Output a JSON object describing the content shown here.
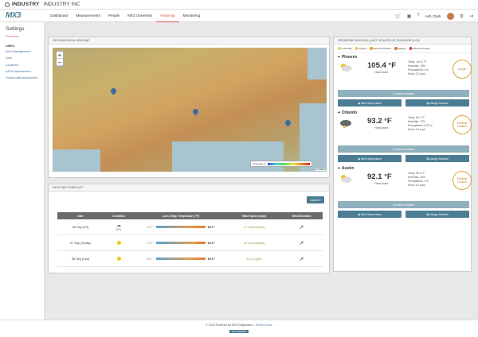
{
  "top": {
    "logo": "INDUSTRY",
    "company": "INDUSTRY INC"
  },
  "nav": {
    "brand": "MX3",
    "items": [
      "Dashboard",
      "Measurements",
      "People",
      "MX3 University",
      "Heatmap",
      "Monitoring"
    ],
    "active": "Heatmap",
    "user": "Ash Clark"
  },
  "sidebar": {
    "title": "Settings",
    "items": [
      "Overview"
    ],
    "links_head": "LINKS",
    "links": [
      "Alert Management",
      "Jobs",
      "Locations",
      "ASSH assessment",
      "Global staff assessment"
    ]
  },
  "map": {
    "title": "GEOGRAPHICAL HEATMAP",
    "zoom_in": "+",
    "zoom_out": "−",
    "legend_label": "Temperature °F",
    "legend_ticks": [
      "60",
      "70",
      "80",
      "90",
      "100",
      "110"
    ],
    "attribution": "© Leaflet"
  },
  "weather": {
    "title": "WEATHER FORECAST",
    "location_select": "Austin",
    "columns": [
      "Date",
      "Condition",
      "Low & High Temperature (°F)",
      "Wind Speed (mph)",
      "Wind Direction"
    ],
    "rows": [
      {
        "date": "06 Sep (Fri)",
        "cond_text": "60%",
        "low": "74.3 °",
        "high": "89.0 °",
        "wind": "17.3 (Moderate)",
        "low_v": 74.3,
        "high_v": 89.0
      },
      {
        "date": "07 Sep (Today)",
        "cond_text": "",
        "low": "74.3 °",
        "high": "92.5 °",
        "wind": "16.6 (Moderate)",
        "low_v": 74.3,
        "high_v": 92.5
      },
      {
        "date": "08 Sep (Sun)",
        "cond_text": "",
        "low": "69.3 °",
        "high": "89.5 °",
        "wind": "11.6 (Light)",
        "low_v": 69.3,
        "high_v": 89.5
      }
    ]
  },
  "regions": {
    "title": "OPERATING REGIONS (LAST UPDATED AT 2024/09/08 14:00)",
    "legend": [
      {
        "label": "Less Risk",
        "color": "#d7e36a"
      },
      {
        "label": "Caution",
        "color": "#f0c02f"
      },
      {
        "label": "Extreme Caution",
        "color": "#f0a02a"
      },
      {
        "label": "Danger",
        "color": "#e0742a"
      },
      {
        "label": "Extreme Danger",
        "color": "#d9342b"
      }
    ],
    "items": [
      {
        "name": "Phoenix",
        "temp": "105.4 °F",
        "heat_index": "Heat Index",
        "stat1": "Temp: 109.3 °F",
        "stat2": "Humidity: 13%",
        "stat3": "Precipitation: 0 in",
        "stat4": "Wind: 2.2 mph",
        "badge": "Danger",
        "workers": "15 Active Workers",
        "alert": "Alert Supervisors",
        "assign": "Assign Session"
      },
      {
        "name": "Orlando",
        "temp": "93.2 °F",
        "heat_index": "Heat Index",
        "stat1": "Temp: 84.9 °F",
        "stat2": "Humidity: 72%",
        "stat3": "Precipitation: 0.03 in",
        "stat4": "Wind: 9.4 mph",
        "badge": "Extreme Caution",
        "workers": "15 Active Workers",
        "alert": "Alert Supervisors",
        "assign": "Assign Session"
      },
      {
        "name": "Austin",
        "temp": "92.1 °F",
        "heat_index": "Heat Index",
        "stat1": "Temp: 90.0 °F",
        "stat2": "Humidity: 44%",
        "stat3": "Precipitation: 0 in",
        "stat4": "Wind: 5.4 mph",
        "badge": "Extreme Caution",
        "workers": "15 Active Workers",
        "alert": "Alert Supervisors",
        "assign": "Assign Session"
      }
    ]
  },
  "footer": {
    "text": "© 2024 Powered by MX3 Diagnostics",
    "sep": " - ",
    "link": "Terms of Use",
    "badge": "MX3 HEATMAP"
  }
}
